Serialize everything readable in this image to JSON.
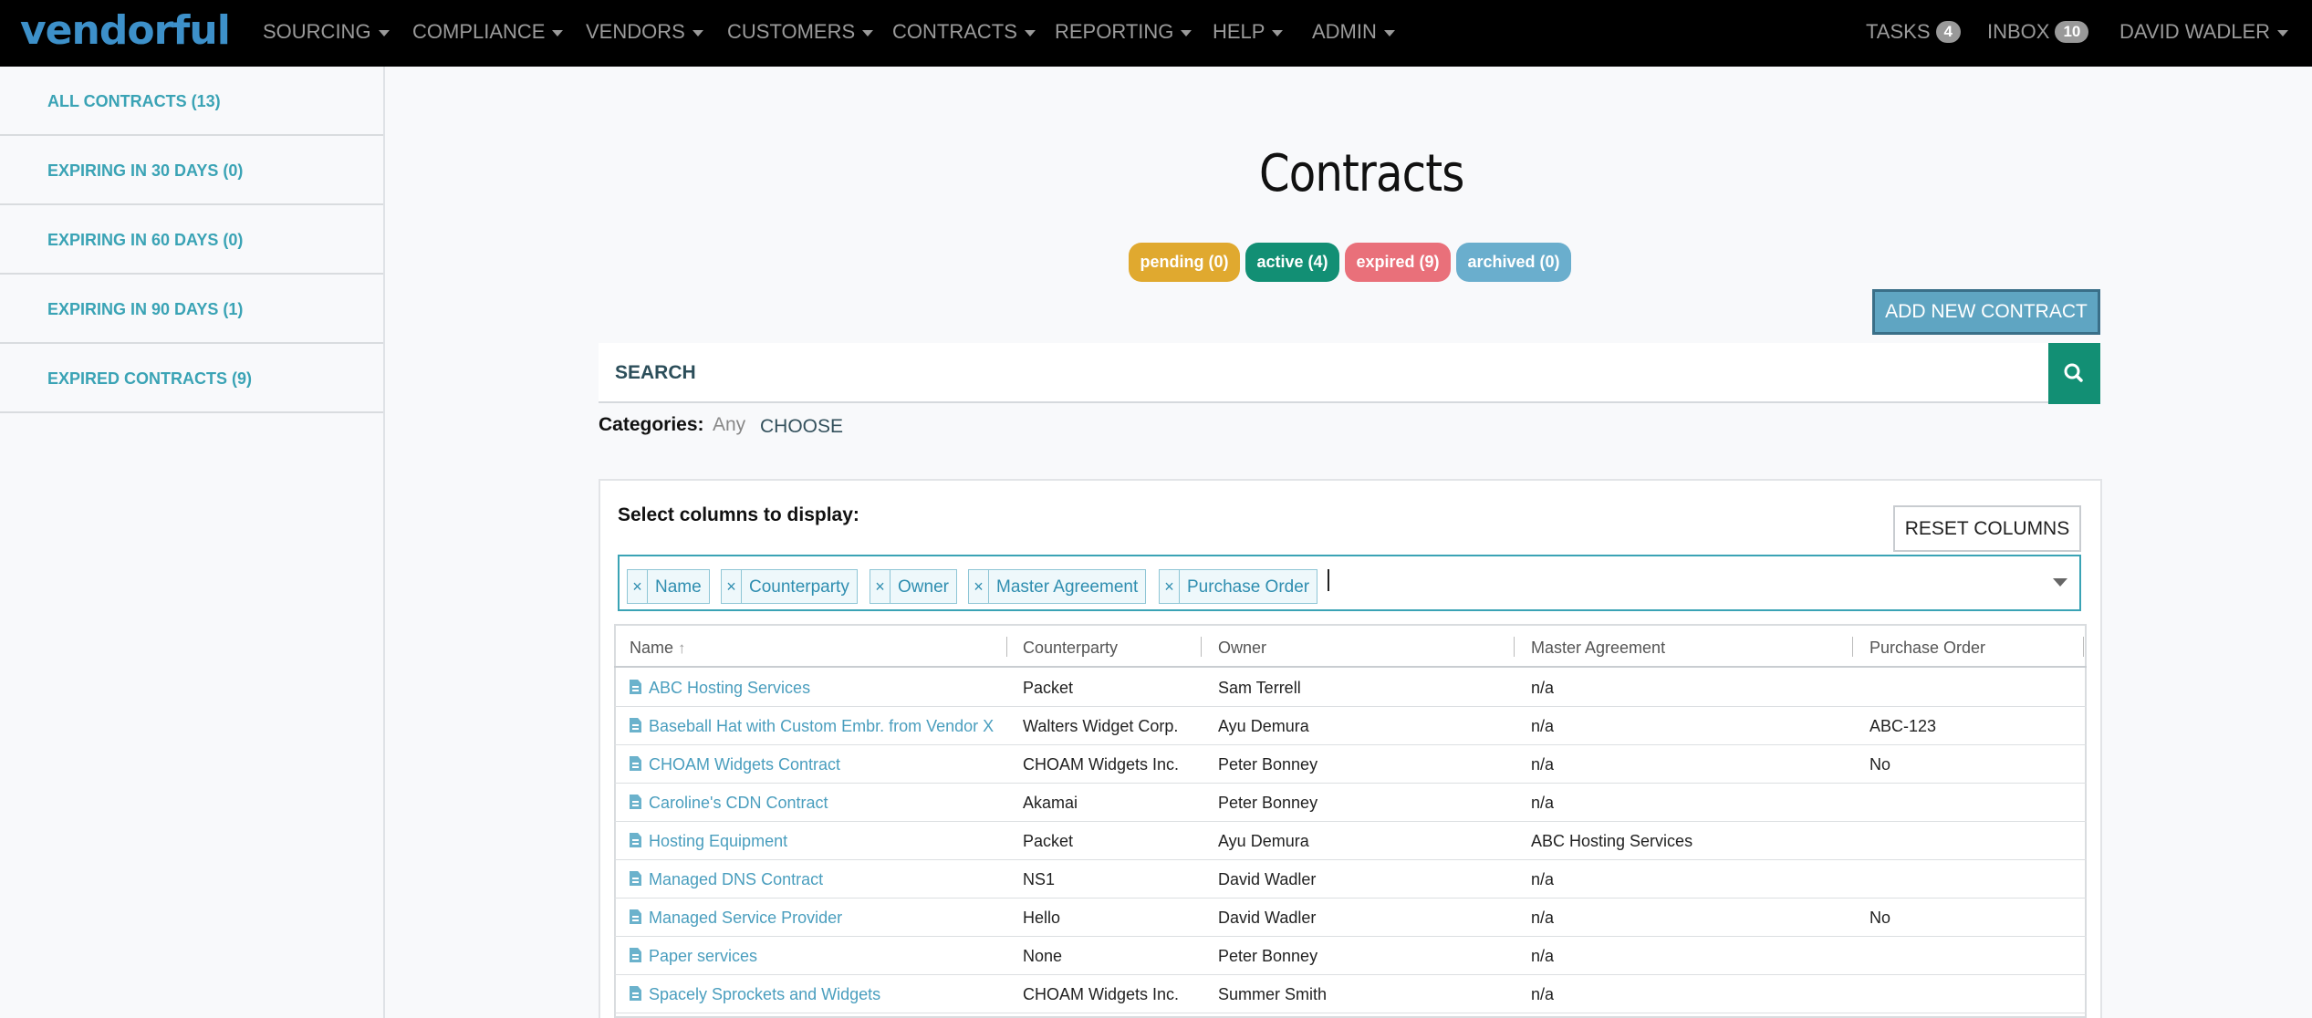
{
  "app": {
    "logo": "vendorful"
  },
  "topnav": {
    "menus": [
      {
        "label": "SOURCING"
      },
      {
        "label": "COMPLIANCE"
      },
      {
        "label": "VENDORS"
      },
      {
        "label": "CUSTOMERS"
      },
      {
        "label": "CONTRACTS"
      },
      {
        "label": "REPORTING"
      },
      {
        "label": "HELP"
      },
      {
        "label": "ADMIN"
      }
    ],
    "tasks": {
      "label": "TASKS",
      "count": "4"
    },
    "inbox": {
      "label": "INBOX",
      "count": "10"
    },
    "user": {
      "label": "DAVID WADLER"
    }
  },
  "sidebar": {
    "items": [
      {
        "label": "ALL CONTRACTS (13)"
      },
      {
        "label": "EXPIRING IN 30 DAYS (0)"
      },
      {
        "label": "EXPIRING IN 60 DAYS (0)"
      },
      {
        "label": "EXPIRING IN 90 DAYS (1)"
      },
      {
        "label": "EXPIRED CONTRACTS (9)"
      }
    ]
  },
  "main": {
    "title": "Contracts",
    "status_filters": [
      {
        "label": "pending (0)",
        "color": "#e0a92f"
      },
      {
        "label": "active (4)",
        "color": "#128f74"
      },
      {
        "label": "expired (9)",
        "color": "#e9707a"
      },
      {
        "label": "archived (0)",
        "color": "#6aaecd"
      }
    ],
    "add_button": "ADD NEW CONTRACT",
    "search": {
      "placeholder": "SEARCH",
      "value": ""
    },
    "categories": {
      "label": "Categories:",
      "value": "Any",
      "choose": "CHOOSE"
    },
    "columns_panel": {
      "label": "Select columns to display:",
      "reset_button": "RESET COLUMNS",
      "selected": [
        "Name",
        "Counterparty",
        "Owner",
        "Master Agreement",
        "Purchase Order"
      ]
    },
    "table": {
      "headers": [
        "Name",
        "Counterparty",
        "Owner",
        "Master Agreement",
        "Purchase Order"
      ],
      "sort": {
        "column": "Name",
        "direction": "asc"
      },
      "rows": [
        {
          "name": "ABC Hosting Services",
          "counterparty": "Packet",
          "owner": "Sam Terrell",
          "master": "n/a",
          "po": ""
        },
        {
          "name": "Baseball Hat with Custom Embr. from Vendor X",
          "counterparty": "Walters Widget Corp.",
          "owner": "Ayu Demura",
          "master": "n/a",
          "po": "ABC-123"
        },
        {
          "name": "CHOAM Widgets Contract",
          "counterparty": "CHOAM Widgets Inc.",
          "owner": "Peter Bonney",
          "master": "n/a",
          "po": "No"
        },
        {
          "name": "Caroline's CDN Contract",
          "counterparty": "Akamai",
          "owner": "Peter Bonney",
          "master": "n/a",
          "po": ""
        },
        {
          "name": "Hosting Equipment",
          "counterparty": "Packet",
          "owner": "Ayu Demura",
          "master": "ABC Hosting Services",
          "po": ""
        },
        {
          "name": "Managed DNS Contract",
          "counterparty": "NS1",
          "owner": "David Wadler",
          "master": "n/a",
          "po": ""
        },
        {
          "name": "Managed Service Provider",
          "counterparty": "Hello",
          "owner": "David Wadler",
          "master": "n/a",
          "po": "No"
        },
        {
          "name": "Paper services",
          "counterparty": "None",
          "owner": "Peter Bonney",
          "master": "n/a",
          "po": ""
        },
        {
          "name": "Spacely Sprockets and Widgets",
          "counterparty": "CHOAM Widgets Inc.",
          "owner": "Summer Smith",
          "master": "n/a",
          "po": ""
        }
      ]
    }
  }
}
